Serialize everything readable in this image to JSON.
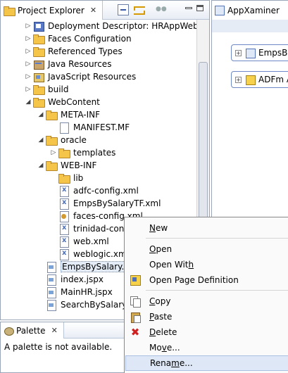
{
  "project_explorer": {
    "title": "Project Explorer",
    "tree": [
      {
        "label": "Deployment Descriptor: HRAppWeb",
        "icon": "deployment-descriptor-icon",
        "level": 1,
        "arrow": "closed"
      },
      {
        "label": "Faces Configuration",
        "icon": "folder-icon",
        "level": 1,
        "arrow": "closed"
      },
      {
        "label": "Referenced Types",
        "icon": "folder-icon",
        "level": 1,
        "arrow": "closed"
      },
      {
        "label": "Java Resources",
        "icon": "library-icon",
        "level": 1,
        "arrow": "closed"
      },
      {
        "label": "JavaScript Resources",
        "icon": "javascript-resources-icon",
        "level": 1,
        "arrow": "closed"
      },
      {
        "label": "build",
        "icon": "folder-icon",
        "level": 1,
        "arrow": "closed"
      },
      {
        "label": "WebContent",
        "icon": "folder-icon",
        "level": 1,
        "arrow": "open"
      },
      {
        "label": "META-INF",
        "icon": "folder-icon",
        "level": 2,
        "arrow": "open"
      },
      {
        "label": "MANIFEST.MF",
        "icon": "file-icon",
        "level": 3,
        "arrow": "none"
      },
      {
        "label": "oracle",
        "icon": "folder-icon",
        "level": 2,
        "arrow": "open"
      },
      {
        "label": "templates",
        "icon": "folder-icon",
        "level": 3,
        "arrow": "closed"
      },
      {
        "label": "WEB-INF",
        "icon": "folder-icon",
        "level": 2,
        "arrow": "open"
      },
      {
        "label": "lib",
        "icon": "folder-icon",
        "level": 3,
        "arrow": "none"
      },
      {
        "label": "adfc-config.xml",
        "icon": "xml-file-icon",
        "level": 3,
        "arrow": "none"
      },
      {
        "label": "EmpsBySalaryTF.xml",
        "icon": "xml-file-icon",
        "level": 3,
        "arrow": "none"
      },
      {
        "label": "faces-config.xml",
        "icon": "config-file-icon",
        "level": 3,
        "arrow": "none"
      },
      {
        "label": "trinidad-confi",
        "icon": "xml-file-icon",
        "level": 3,
        "arrow": "none"
      },
      {
        "label": "web.xml",
        "icon": "xml-file-icon",
        "level": 3,
        "arrow": "none"
      },
      {
        "label": "weblogic.xml",
        "icon": "xml-file-icon",
        "level": 3,
        "arrow": "none"
      },
      {
        "label": "EmpsBySalary.jsff",
        "icon": "jsp-file-icon",
        "level": 2,
        "arrow": "none",
        "selected": true
      },
      {
        "label": "index.jspx",
        "icon": "jsp-file-icon",
        "level": 2,
        "arrow": "none"
      },
      {
        "label": "MainHR.jspx",
        "icon": "jsp-file-icon",
        "level": 2,
        "arrow": "none"
      },
      {
        "label": "SearchBySalary.jsf",
        "icon": "jsp-file-icon",
        "level": 2,
        "arrow": "none"
      }
    ]
  },
  "appxaminer": {
    "title": "AppXaminer",
    "nodes": [
      {
        "label": "EmpsBy",
        "icon": "flow-icon"
      },
      {
        "label": "ADFm A",
        "icon": "page-definition-icon"
      }
    ]
  },
  "palette": {
    "title": "Palette",
    "message": "A palette is not available."
  },
  "context_menu": {
    "items": [
      {
        "label": "New",
        "mnemonic": "N",
        "icon": "",
        "highlighted": false
      },
      {
        "type": "separator"
      },
      {
        "label": "Open",
        "mnemonic": "O",
        "icon": "",
        "highlighted": false
      },
      {
        "label": "Open With",
        "mnemonic": "h",
        "icon": "",
        "highlighted": false
      },
      {
        "label": "Open Page Definition",
        "mnemonic": "",
        "icon": "page-definition-icon",
        "highlighted": false
      },
      {
        "type": "separator"
      },
      {
        "label": "Copy",
        "mnemonic": "C",
        "icon": "copy-icon",
        "highlighted": false
      },
      {
        "label": "Paste",
        "mnemonic": "P",
        "icon": "paste-icon",
        "highlighted": false
      },
      {
        "label": "Delete",
        "mnemonic": "D",
        "icon": "delete-icon",
        "highlighted": false
      },
      {
        "label": "Move...",
        "mnemonic": "v",
        "icon": "",
        "highlighted": false
      },
      {
        "label": "Rename...",
        "mnemonic": "m",
        "icon": "",
        "highlighted": true
      }
    ]
  }
}
